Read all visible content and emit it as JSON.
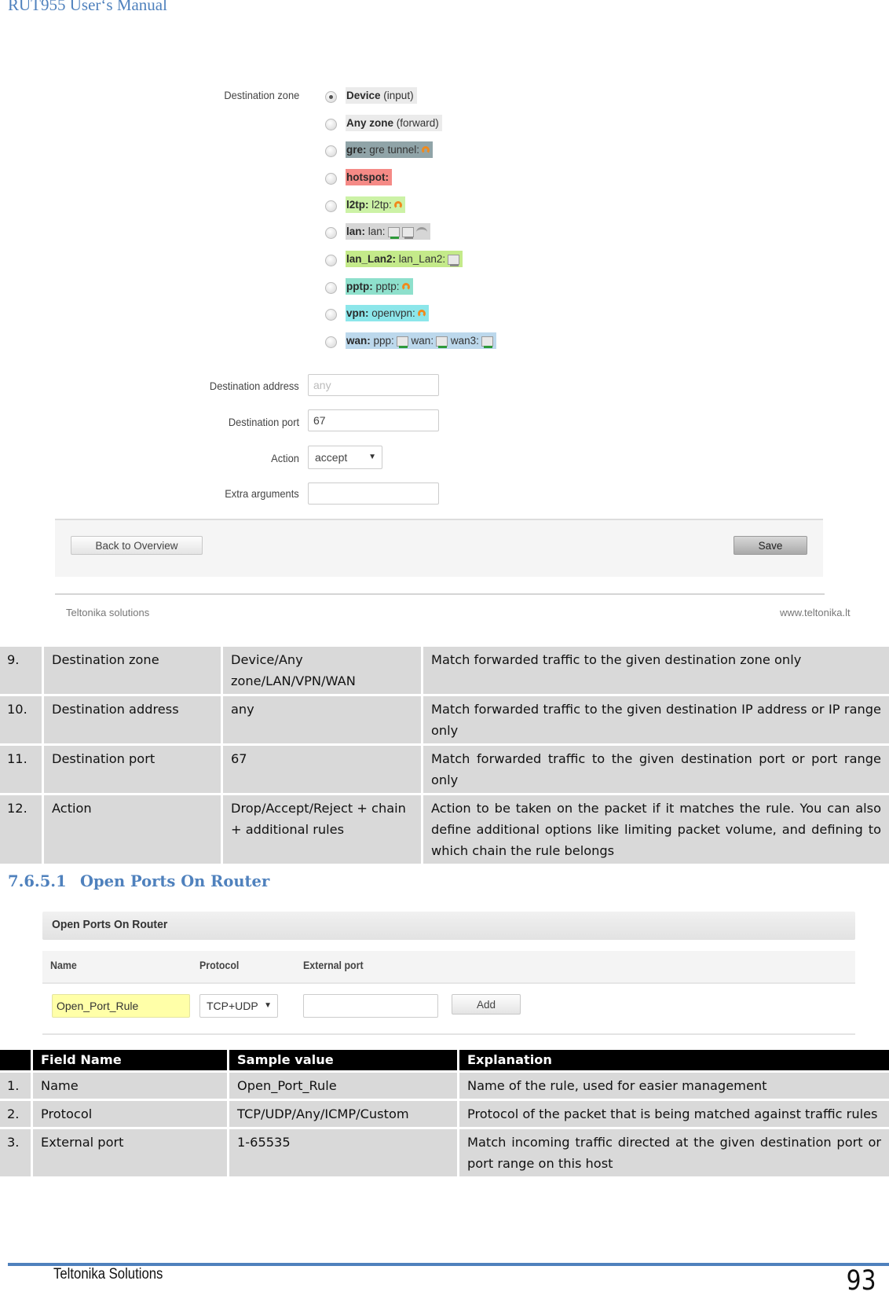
{
  "header": {
    "manual_title": "RUT955 User‘s Manual"
  },
  "traffic_rule_screenshot": {
    "destination_zone_label": "Destination zone",
    "zones": [
      {
        "key": "Device",
        "suffix": " (input)",
        "selected": true,
        "bg": "#ebebeb",
        "icons": []
      },
      {
        "key": "Any zone",
        "suffix": " (forward)",
        "selected": false,
        "bg": "#ebebeb",
        "icons": []
      },
      {
        "key": "gre:",
        "suffix": " gre tunnel:",
        "selected": false,
        "bg": "#90a4a8",
        "icons": [
          "tunnel-icon"
        ]
      },
      {
        "key": "hotspot:",
        "suffix": "",
        "selected": false,
        "bg": "#f58a86",
        "icons": []
      },
      {
        "key": "l2tp:",
        "suffix": " l2tp:",
        "selected": false,
        "bg": "#ccf2a6",
        "icons": [
          "tunnel-icon"
        ]
      },
      {
        "key": "lan:",
        "suffix": " lan:",
        "selected": false,
        "bg": "#d6d6d6",
        "icons": [
          "ethernet-port-icon",
          "ethernet-port-inactive-icon",
          "wifi-icon"
        ]
      },
      {
        "key": "lan_Lan2:",
        "suffix": " lan_Lan2:",
        "selected": false,
        "bg": "#c4ea8a",
        "icons": [
          "ethernet-port-inactive-icon"
        ]
      },
      {
        "key": "pptp:",
        "suffix": " pptp:",
        "selected": false,
        "bg": "#8ee0cc",
        "icons": [
          "tunnel-icon"
        ]
      },
      {
        "key": "vpn:",
        "suffix": " openvpn:",
        "selected": false,
        "bg": "#8ce6ea",
        "icons": [
          "vpn-tunnel-icon"
        ]
      },
      {
        "key": "wan:",
        "suffix": " ppp:",
        "suffix2": " wan:",
        "suffix3": " wan3:",
        "selected": false,
        "bg": "#bcd8ec",
        "icons": [
          "ethernet-port-icon",
          "ethernet-port-icon",
          "ethernet-port-icon"
        ]
      }
    ],
    "destination_address_label": "Destination address",
    "destination_address_placeholder": "any",
    "destination_port_label": "Destination port",
    "destination_port_value": "67",
    "action_label": "Action",
    "action_value": "accept",
    "extra_arguments_label": "Extra arguments",
    "extra_arguments_value": "",
    "back_button": "Back to Overview",
    "save_button": "Save",
    "footer_left": "Teltonika solutions",
    "footer_right": "www.teltonika.lt"
  },
  "table1": {
    "rows": [
      {
        "num": "9.",
        "field": "Destination zone",
        "value": "Device/Any zone/LAN/VPN/WAN",
        "explanation": "Match forwarded traffic to the given destination zone only"
      },
      {
        "num": "10.",
        "field": "Destination address",
        "value": "any",
        "explanation": "Match forwarded traffic to the given destination IP address or IP range only"
      },
      {
        "num": "11.",
        "field": "Destination port",
        "value": "67",
        "explanation": "Match forwarded traffic to the given destination port or port range only"
      },
      {
        "num": "12.",
        "field": "Action",
        "value": "Drop/Accept/Reject + chain + additional rules",
        "explanation": "Action to be taken on the packet if it matches the rule. You can also define additional options like limiting packet volume, and defining to which chain the rule belongs"
      }
    ]
  },
  "section": {
    "number": "7.6.5.1",
    "title": "Open Ports On Router"
  },
  "open_ports_screenshot": {
    "panel_title": "Open Ports On Router",
    "columns": [
      "Name",
      "Protocol",
      "External port"
    ],
    "name_value": "Open_Port_Rule",
    "protocol_value": "TCP+UDP",
    "external_port_value": "",
    "add_button": "Add"
  },
  "table2": {
    "headers": [
      "",
      "Field Name",
      "Sample value",
      "Explanation"
    ],
    "rows": [
      {
        "num": "1.",
        "field": "Name",
        "value": "Open_Port_Rule",
        "explanation": "Name of the rule, used for easier management"
      },
      {
        "num": "2.",
        "field": "Protocol",
        "value": "TCP/UDP/Any/ICMP/Custom",
        "explanation": "Protocol of the packet that is being matched against traffic rules"
      },
      {
        "num": "3.",
        "field": "External port",
        "value": "1-65535",
        "explanation": "Match incoming traffic directed at the given destination port or port range on this host"
      }
    ]
  },
  "footer": {
    "company": "Teltonika Solutions",
    "page_number": "93"
  },
  "colors": {
    "accent_blue": "#4f81bd",
    "table_cell": "#d9d9d9",
    "table_header": "#000000",
    "name_field_highlight": "#ffffa8"
  }
}
